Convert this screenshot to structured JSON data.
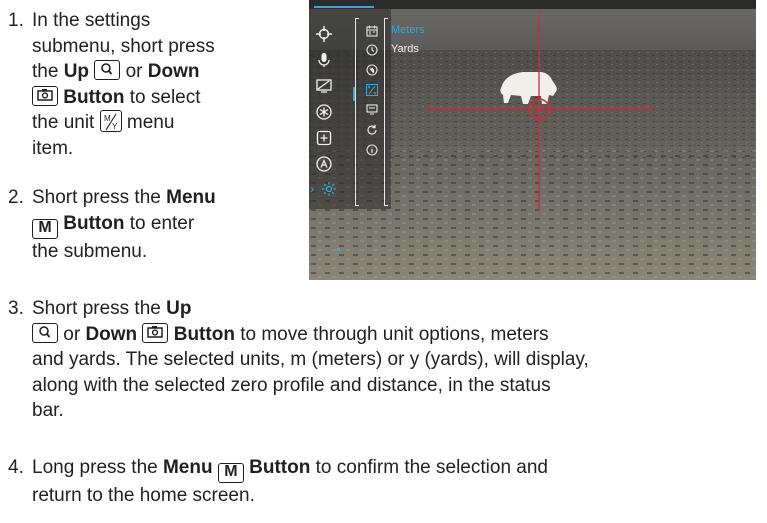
{
  "steps": [
    {
      "number": "1.",
      "line1": "In the settings",
      "line2": "submenu, short press",
      "line3_pre": "the ",
      "up": "Up",
      "or": " or ",
      "down": "Down",
      "line4_post": " Button",
      "line4_tail": " to select",
      "line5_pre": "the unit ",
      "line5_post": " menu",
      "line6": "item."
    },
    {
      "number": "2.",
      "line1_pre": "Short press the ",
      "menu": "Menu",
      "key_label": "M",
      "line2_post": " Button",
      "line2_tail": " to enter",
      "line3": "the submenu."
    },
    {
      "number": "3.",
      "line1_pre": "Short press the ",
      "up": "Up",
      "or": " or ",
      "down": "Down",
      "button": " Button",
      "line2_tail": " to move through unit options, meters",
      "line3": "and yards. The selected units, m (meters) or y (yards), will display,",
      "line4": "along with the selected zero profile and distance, in the status",
      "line5": "bar."
    },
    {
      "number": "4.",
      "line1_pre": "Long press the ",
      "menu": "Menu",
      "key_label": "M",
      "button": " Button",
      "line1_tail": " to confirm the selection and",
      "line2": "return to the home screen."
    }
  ],
  "device_screen": {
    "options": [
      "Meters",
      "Yards"
    ],
    "selected_option": "Meters",
    "colors": {
      "accent": "#3aa7d8",
      "reticle": "#e0252f",
      "menu_text": "#f2f2f2"
    },
    "menu_icons": [
      "crosshair-icon",
      "microphone-icon",
      "display-icon",
      "asterisk-icon",
      "square-plus-icon",
      "a-circle-icon",
      "gear-icon"
    ],
    "submenu_icons": [
      "calendar-icon",
      "clock-icon",
      "globe-icon",
      "units-icon",
      "display-mode-icon",
      "reset-icon",
      "info-icon"
    ]
  }
}
